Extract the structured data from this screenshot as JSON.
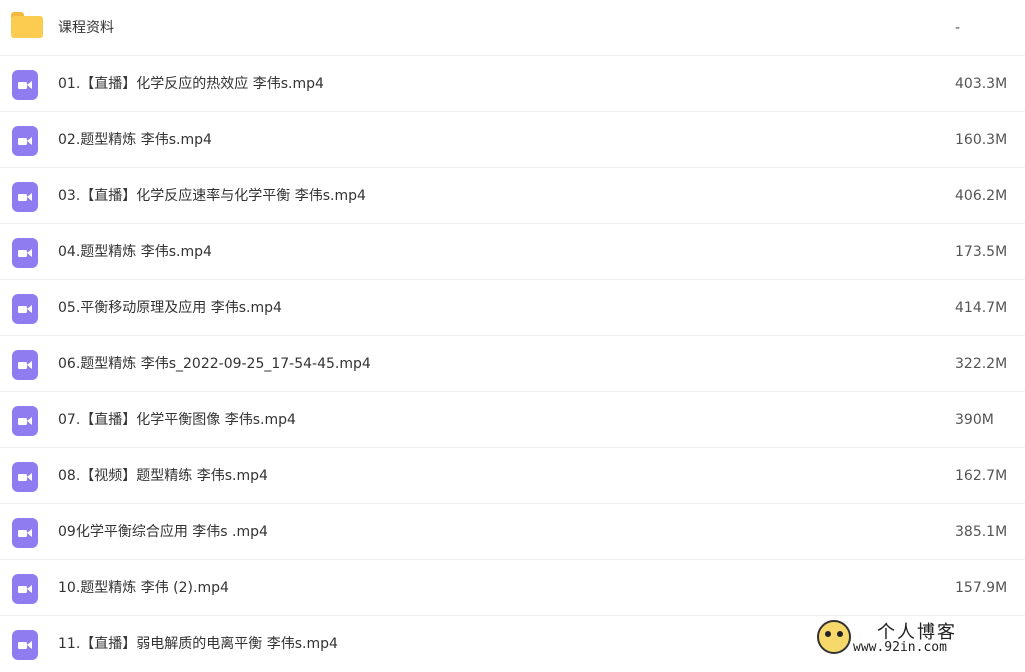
{
  "files": [
    {
      "type": "folder",
      "name": "课程资料",
      "size": "-"
    },
    {
      "type": "video",
      "name": "01.【直播】化学反应的热效应 李伟s.mp4",
      "size": "403.3M"
    },
    {
      "type": "video",
      "name": "02.题型精炼 李伟s.mp4",
      "size": "160.3M"
    },
    {
      "type": "video",
      "name": "03.【直播】化学反应速率与化学平衡 李伟s.mp4",
      "size": "406.2M"
    },
    {
      "type": "video",
      "name": "04.题型精炼 李伟s.mp4",
      "size": "173.5M"
    },
    {
      "type": "video",
      "name": "05.平衡移动原理及应用 李伟s.mp4",
      "size": "414.7M"
    },
    {
      "type": "video",
      "name": "06.题型精炼 李伟s_2022-09-25_17-54-45.mp4",
      "size": "322.2M"
    },
    {
      "type": "video",
      "name": "07.【直播】化学平衡图像 李伟s.mp4",
      "size": "390M"
    },
    {
      "type": "video",
      "name": "08.【视频】题型精练 李伟s.mp4",
      "size": "162.7M"
    },
    {
      "type": "video",
      "name": "09化学平衡综合应用 李伟s .mp4",
      "size": "385.1M"
    },
    {
      "type": "video",
      "name": "10.题型精炼 李伟 (2).mp4",
      "size": "157.9M"
    },
    {
      "type": "video",
      "name": "11.【直播】弱电解质的电离平衡 李伟s.mp4",
      "size": ""
    }
  ],
  "watermark": {
    "title": "个人博客",
    "url": "www.92in.com"
  }
}
